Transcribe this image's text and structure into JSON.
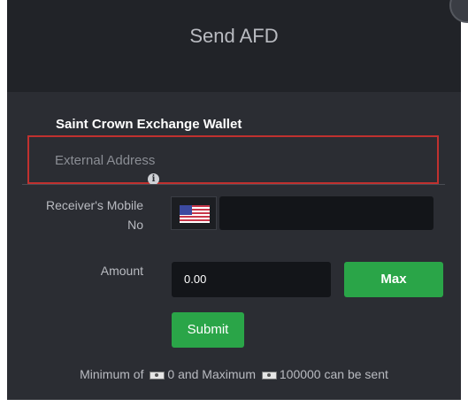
{
  "modal": {
    "title": "Send AFD"
  },
  "form": {
    "wallet_label": "Saint Crown Exchange Wallet",
    "external_address_label": "External Address",
    "receiver_mobile_label_line1": "Receiver's Mobile",
    "receiver_mobile_label_line2": "No",
    "receiver_mobile_value": "",
    "country_flag": "us-flag-icon",
    "amount_label": "Amount",
    "amount_value": "0.00",
    "max_label": "Max",
    "submit_label": "Submit"
  },
  "limits": {
    "prefix": "Minimum of",
    "min": "0",
    "middle": "and Maximum",
    "max": "100000",
    "suffix": "can be sent"
  },
  "colors": {
    "accent_green": "#2aa548",
    "highlight_red": "#c0312f",
    "panel_bg": "#2b2d33",
    "header_bg": "#212328"
  }
}
